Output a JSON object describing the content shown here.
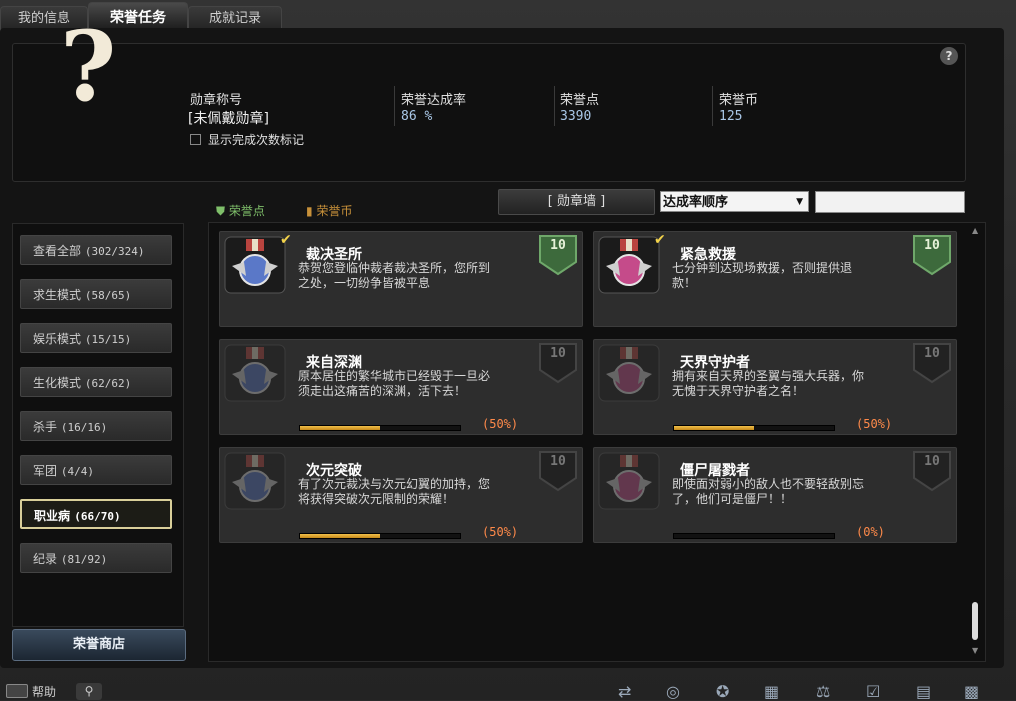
{
  "tabs": [
    "我的信息",
    "荣誉任务",
    "成就记录"
  ],
  "header": {
    "medal_title_label": "勋章称号",
    "medal_title_value": "[未佩戴勋章]",
    "show_marks_label": "显示完成次数标记",
    "completion_label": "荣誉达成率",
    "completion_value": "86 %",
    "points_label": "荣誉点",
    "points_value": "3390",
    "coins_label": "荣誉币",
    "coins_value": "125",
    "help": "?"
  },
  "filters": {
    "points": "荣誉点",
    "coins": "荣誉币",
    "medal_wall": "[ 勋章墙 ]",
    "sort_selected": "达成率顺序",
    "search_value": ""
  },
  "sidebar": {
    "items": [
      {
        "label": "查看全部",
        "count": "(302/324)"
      },
      {
        "label": "求生模式",
        "count": "(58/65)"
      },
      {
        "label": "娱乐模式",
        "count": "(15/15)"
      },
      {
        "label": "生化模式",
        "count": "(62/62)"
      },
      {
        "label": "杀手",
        "count": "(16/16)"
      },
      {
        "label": "军团",
        "count": "(4/4)"
      },
      {
        "label": "职业病",
        "count": "(66/70)"
      },
      {
        "label": "纪录",
        "count": "(81/92)"
      }
    ],
    "active_index": 6,
    "shop_label": "荣誉商店"
  },
  "cards": [
    {
      "title": "裁决圣所",
      "desc": "恭贺您登临仲裁者裁决圣所，您所到之处，一切纷争皆被平息",
      "points": "10",
      "completed": true,
      "progress_text": "",
      "progress": 1.0
    },
    {
      "title": "紧急救援",
      "desc": "七分钟到达现场救援，否则提供退款！",
      "points": "10",
      "completed": true,
      "progress_text": "",
      "progress": 1.0
    },
    {
      "title": "来自深渊",
      "desc": "原本居住的繁华城市已经毁于一旦必须走出这痛苦的深渊，活下去！",
      "points": "10",
      "completed": false,
      "progress_text": "(50%)",
      "progress": 0.5
    },
    {
      "title": "天界守护者",
      "desc": "拥有来自天界的圣翼与强大兵器，你无愧于天界守护者之名！",
      "points": "10",
      "completed": false,
      "progress_text": "(50%)",
      "progress": 0.5
    },
    {
      "title": "次元突破",
      "desc": "有了次元裁决与次元幻翼的加持，您将获得突破次元限制的荣耀！",
      "points": "10",
      "completed": false,
      "progress_text": "(50%)",
      "progress": 0.5
    },
    {
      "title": "僵尸屠戮者",
      "desc": "即使面对弱小的敌人也不要轻敌别忘了，他们可是僵尸！！",
      "points": "10",
      "completed": false,
      "progress_text": "(0%)",
      "progress": 0.0
    }
  ],
  "footer": {
    "help_label": "帮助"
  },
  "colors": {
    "completed_shield": "#3d6a3c",
    "progress": "#e0a83a",
    "percent": "#ff8a4a"
  }
}
